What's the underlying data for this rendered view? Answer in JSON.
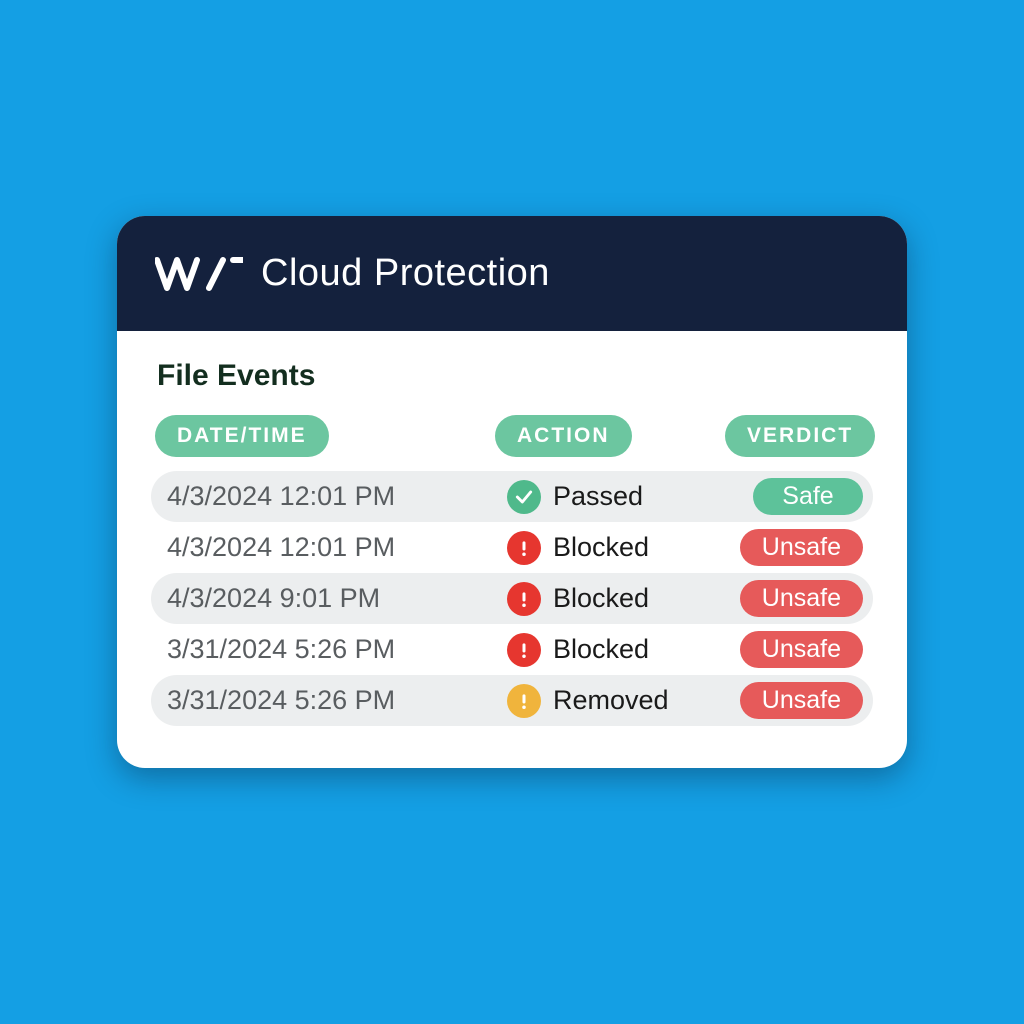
{
  "header": {
    "title": "Cloud Protection"
  },
  "section": {
    "title": "File Events"
  },
  "columns": {
    "date": "DATE/TIME",
    "action": "ACTION",
    "verdict": "VERDICT"
  },
  "icons": {
    "green": "check-circle-icon",
    "red": "alert-circle-icon",
    "yellow": "alert-circle-icon"
  },
  "verdict_styles": {
    "Safe": "v-safe",
    "Unsafe": "v-unsafe"
  },
  "events": [
    {
      "date": "4/3/2024 12:01 PM",
      "action": "Passed",
      "action_icon": "green",
      "verdict": "Safe"
    },
    {
      "date": "4/3/2024 12:01 PM",
      "action": "Blocked",
      "action_icon": "red",
      "verdict": "Unsafe"
    },
    {
      "date": "4/3/2024 9:01 PM",
      "action": "Blocked",
      "action_icon": "red",
      "verdict": "Unsafe"
    },
    {
      "date": "3/31/2024 5:26 PM",
      "action": "Blocked",
      "action_icon": "red",
      "verdict": "Unsafe"
    },
    {
      "date": "3/31/2024 5:26 PM",
      "action": "Removed",
      "action_icon": "yellow",
      "verdict": "Unsafe"
    }
  ]
}
